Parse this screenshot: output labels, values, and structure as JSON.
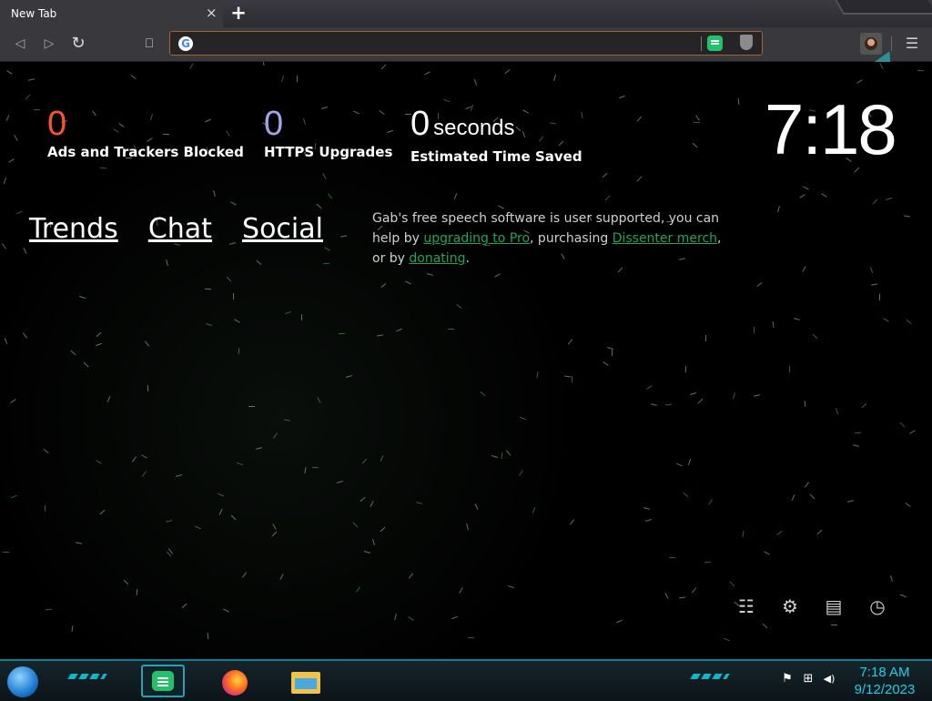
{
  "browser": {
    "tab_title": "New Tab",
    "tab_close": "×",
    "new_tab": "+",
    "url_value": "",
    "back_icon": "◁",
    "forward_icon": "▷",
    "reload_icon": "↻",
    "bookmark_icon": "⎕",
    "menu_icon": "☰",
    "google_letter": "G"
  },
  "stats": {
    "ads": {
      "value": "0",
      "label": "Ads and Trackers Blocked"
    },
    "https": {
      "value": "0",
      "label": "HTTPS Upgrades"
    },
    "time": {
      "value": "0",
      "unit": "seconds",
      "label": "Estimated Time Saved"
    }
  },
  "clock": "7:18",
  "top_links": [
    "Trends",
    "Chat",
    "Social"
  ],
  "support": {
    "text1": "Gab's free speech software is user supported, you can help by ",
    "link1": "upgrading to Pro",
    "text2": ", purchasing ",
    "link2": "Dissenter merch",
    "text3": ", or by ",
    "link3": "donating",
    "text4": "."
  },
  "ntp_icons": {
    "customize": "☷",
    "settings": "⚙",
    "bookmarks": "▤",
    "history": "◷"
  },
  "taskbar": {
    "time": "7:18 AM",
    "date": "9/12/2023",
    "flag_icon": "⚑",
    "network_icon": "⊞",
    "volume_icon": "◀)"
  }
}
